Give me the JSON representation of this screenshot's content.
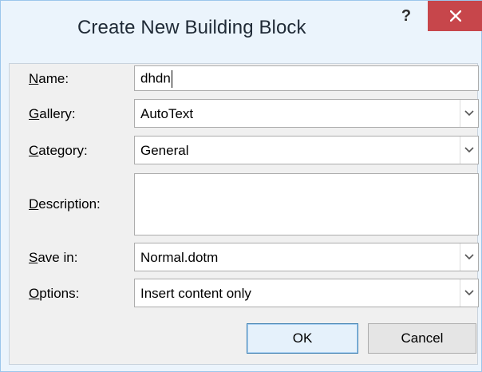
{
  "dialog": {
    "title": "Create New Building Block",
    "help_label": "?",
    "close_icon": "close-x-icon"
  },
  "fields": {
    "name": {
      "label_u": "N",
      "label_rest": "ame:",
      "value": "dhdn"
    },
    "gallery": {
      "label_u": "G",
      "label_rest": "allery:",
      "value": "AutoText"
    },
    "category": {
      "label_u": "C",
      "label_rest": "ategory:",
      "value": "General"
    },
    "description": {
      "label_u": "D",
      "label_rest": "escription:",
      "value": ""
    },
    "save_in": {
      "label_u": "S",
      "label_rest": "ave in:",
      "value": "Normal.dotm"
    },
    "options": {
      "label_u": "O",
      "label_rest": "ptions:",
      "value": "Insert content only"
    }
  },
  "buttons": {
    "ok": "OK",
    "cancel": "Cancel"
  },
  "colors": {
    "frame": "#ebf4fc",
    "close_button": "#c7464b",
    "client_bg": "#f0f0f0"
  }
}
